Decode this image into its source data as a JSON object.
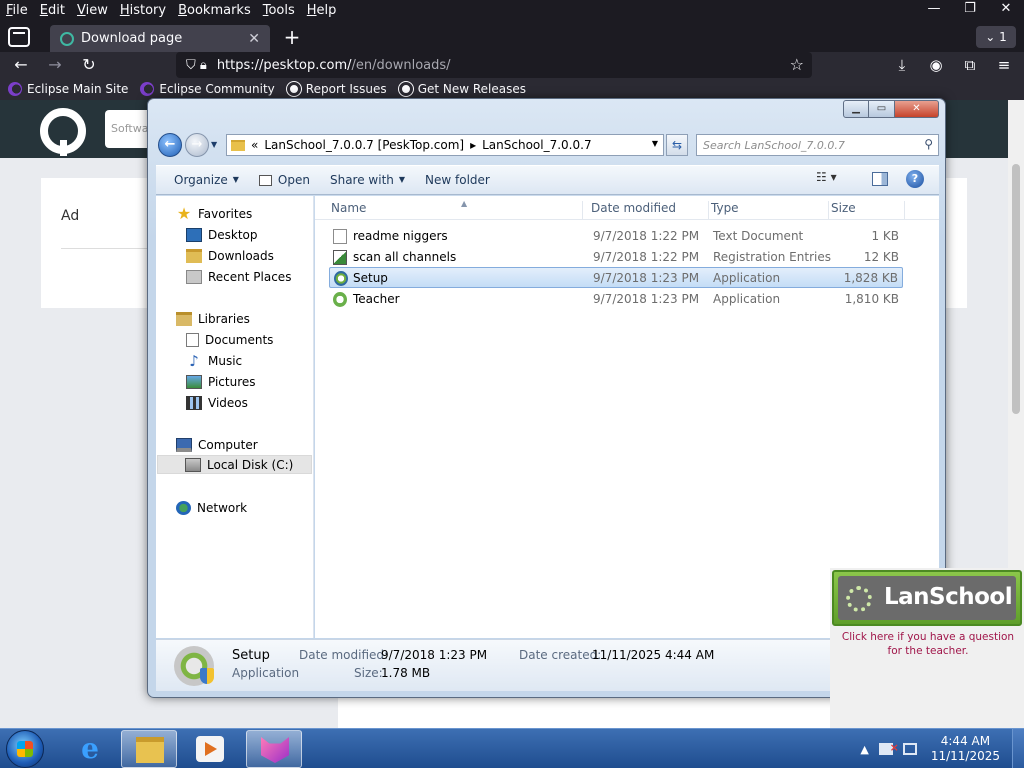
{
  "firefox": {
    "menu": [
      "File",
      "Edit",
      "View",
      "History",
      "Bookmarks",
      "Tools",
      "Help"
    ],
    "window_controls": {
      "minimize": "—",
      "restore": "❐",
      "close": "✕"
    },
    "tab": {
      "title": "Download page",
      "close": "✕"
    },
    "new_tab": "+",
    "tab_count": "⌄ 1",
    "nav": {
      "back": "←",
      "forward": "→",
      "reload": "↻"
    },
    "url": {
      "host": "https://pesktop.com/",
      "path": "/en/downloads/"
    },
    "bookmarks": [
      "Eclipse Main Site",
      "Eclipse Community",
      "Report Issues",
      "Get New Releases"
    ]
  },
  "web_page": {
    "search_placeholder": "Softwa",
    "ad_label": "Ad"
  },
  "explorer": {
    "address_crumbs": [
      "«",
      "LanSchool_7.0.0.7 [PeskTop.com]",
      "▸",
      "LanSchool_7.0.0.7"
    ],
    "search_placeholder": "Search LanSchool_7.0.0.7",
    "toolbar": {
      "organize": "Organize",
      "open": "Open",
      "share_with": "Share with",
      "new_folder": "New folder"
    },
    "nav_pane": {
      "favorites": "Favorites",
      "desktop": "Desktop",
      "downloads": "Downloads",
      "recent_places": "Recent Places",
      "libraries": "Libraries",
      "documents": "Documents",
      "music": "Music",
      "pictures": "Pictures",
      "videos": "Videos",
      "computer": "Computer",
      "local_disk": "Local Disk (C:)",
      "network": "Network"
    },
    "columns": {
      "name": "Name",
      "date_modified": "Date modified",
      "type": "Type",
      "size": "Size"
    },
    "files": [
      {
        "name": "readme niggers",
        "date": "9/7/2018 1:22 PM",
        "type": "Text Document",
        "size": "1 KB"
      },
      {
        "name": "scan all channels",
        "date": "9/7/2018 1:22 PM",
        "type": "Registration Entries",
        "size": "12 KB"
      },
      {
        "name": "Setup",
        "date": "9/7/2018 1:23 PM",
        "type": "Application",
        "size": "1,828 KB"
      },
      {
        "name": "Teacher",
        "date": "9/7/2018 1:23 PM",
        "type": "Application",
        "size": "1,810 KB"
      }
    ],
    "details": {
      "name": "Setup",
      "kind": "Application",
      "date_modified_label": "Date modified:",
      "date_modified": "9/7/2018 1:23 PM",
      "size_label": "Size:",
      "size": "1.78 MB",
      "date_created_label": "Date created:",
      "date_created": "11/11/2025 4:44 AM"
    }
  },
  "lanschool": {
    "name": "LanSchool",
    "message": "Click here if you have a question for the teacher."
  },
  "taskbar": {
    "time": "4:44 AM",
    "date": "11/11/2025",
    "tray_arrow": "▲"
  }
}
